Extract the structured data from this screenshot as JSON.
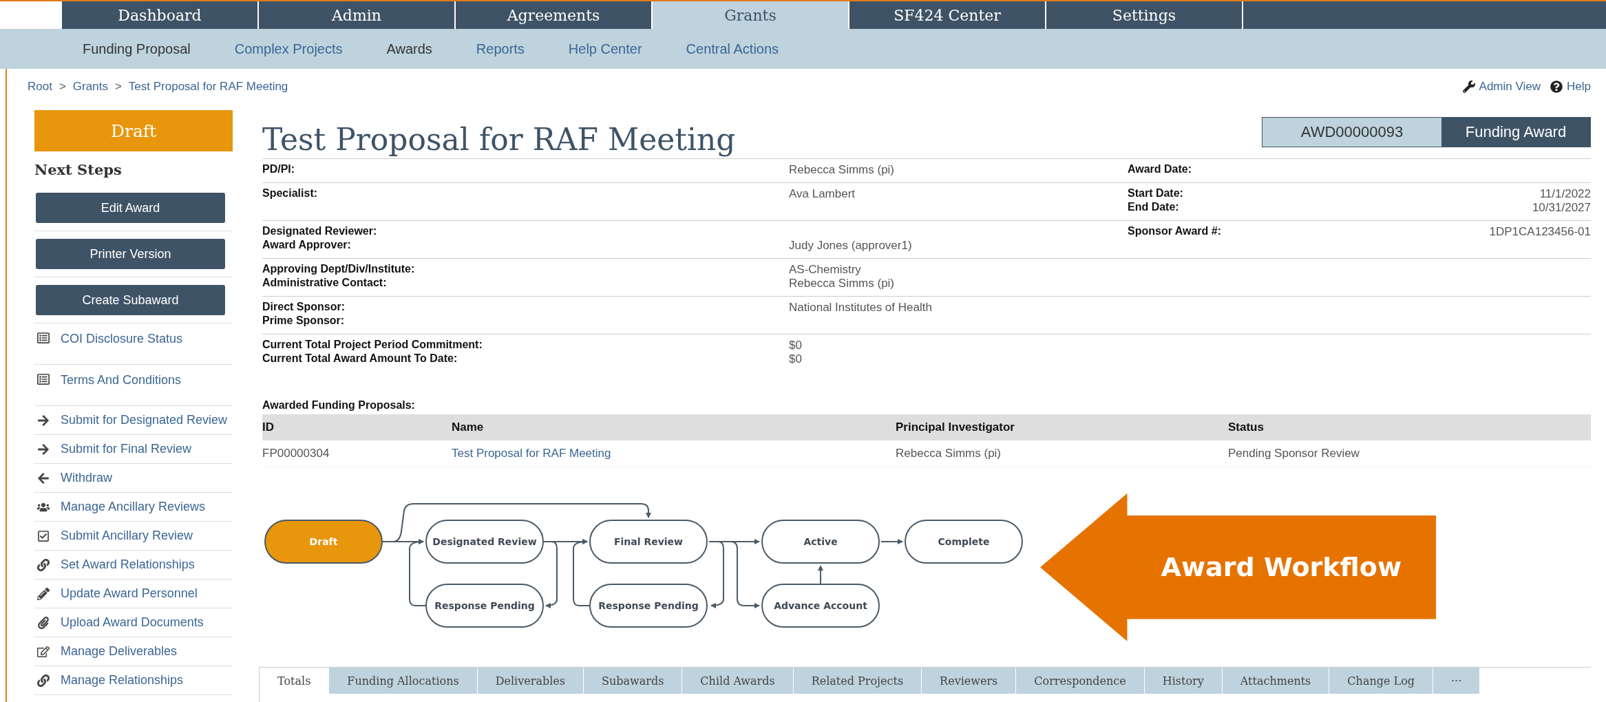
{
  "top_nav": [
    {
      "label": "Dashboard",
      "selected": false
    },
    {
      "label": "Admin",
      "selected": false
    },
    {
      "label": "Agreements",
      "selected": false
    },
    {
      "label": "Grants",
      "selected": true
    },
    {
      "label": "SF424 Center",
      "selected": false
    },
    {
      "label": "Settings",
      "selected": false
    }
  ],
  "sub_nav": [
    {
      "label": "Funding Proposal",
      "selected": true
    },
    {
      "label": "Complex Projects",
      "selected": false
    },
    {
      "label": "Awards",
      "selected": true
    },
    {
      "label": "Reports",
      "selected": false
    },
    {
      "label": "Help Center",
      "selected": false
    },
    {
      "label": "Central Actions",
      "selected": false
    }
  ],
  "breadcrumb": {
    "items": [
      "Root",
      "Grants",
      "Test Proposal for RAF Meeting"
    ],
    "separator": ">"
  },
  "header_links": [
    {
      "kind": "wrench",
      "label": "Admin View"
    },
    {
      "kind": "help",
      "label": "Help"
    }
  ],
  "sidebar": {
    "state": "Draft",
    "next_steps_title": "Next Steps",
    "buttons": [
      "Edit Award",
      "Printer Version",
      "Create Subaward"
    ],
    "items": [
      {
        "kind": "list",
        "label": "COI Disclosure Status"
      },
      {
        "kind": "list",
        "label": "Terms And Conditions"
      },
      {
        "kind": "forward",
        "label": "Submit for Designated Review"
      },
      {
        "kind": "forward",
        "label": "Submit for Final Review"
      },
      {
        "kind": "back",
        "label": "Withdraw"
      },
      {
        "kind": "users",
        "label": "Manage Ancillary Reviews"
      },
      {
        "kind": "check",
        "label": "Submit Ancillary Review"
      },
      {
        "kind": "link",
        "label": "Set Award Relationships"
      },
      {
        "kind": "pencil",
        "label": "Update Award Personnel"
      },
      {
        "kind": "clip",
        "label": "Upload Award Documents"
      },
      {
        "kind": "edit",
        "label": "Manage Deliverables"
      },
      {
        "kind": "link",
        "label": "Manage Relationships"
      }
    ]
  },
  "title": "Test Proposal for RAF Meeting",
  "award_id": "AWD00000093",
  "award_type": "Funding Award",
  "details": [
    {
      "lines": [
        {
          "label": "PD/PI:",
          "value": "Rebecca Simms (pi)",
          "right_label": "Award Date:"
        }
      ]
    },
    {
      "lines": [
        {
          "label": "Specialist:",
          "value": "Ava Lambert",
          "right_label": "Start Date:",
          "right_value": "11/1/2022"
        },
        {
          "right_label": "End Date:",
          "right_value": "10/31/2027"
        }
      ]
    },
    {
      "lines": [
        {
          "label": "Designated Reviewer:",
          "right_label": "Sponsor Award #:",
          "right_value": "1DP1CA123456-01"
        },
        {
          "label": "Award Approver:",
          "value": "Judy Jones (approver1)"
        }
      ]
    },
    {
      "lines": [
        {
          "label": "Approving Dept/Div/Institute:",
          "value": "AS-Chemistry"
        },
        {
          "label": "Administrative Contact:",
          "value": "Rebecca Simms (pi)"
        }
      ]
    },
    {
      "lines": [
        {
          "label": "Direct Sponsor:",
          "value": "National Institutes of Health"
        },
        {
          "label": "Prime Sponsor:"
        }
      ]
    },
    {
      "lines": [
        {
          "label": "Current Total Project Period Commitment:",
          "value": "$0"
        },
        {
          "label": "Current Total Award Amount To Date:",
          "value": "$0"
        }
      ]
    }
  ],
  "proposals": {
    "title": "Awarded Funding Proposals:",
    "columns": [
      "ID",
      "Name",
      "Principal Investigator",
      "Status"
    ],
    "rows": [
      [
        "FP00000304",
        "Test Proposal for RAF Meeting",
        "Rebecca Simms (pi)",
        "Pending Sponsor Review"
      ]
    ]
  },
  "workflow": {
    "nodes": [
      {
        "label": "Draft",
        "selected": true
      },
      {
        "label": "Designated Review",
        "selected": false
      },
      {
        "label": "Final Review",
        "selected": false
      },
      {
        "label": "Active",
        "selected": false
      },
      {
        "label": "Complete",
        "selected": false
      },
      {
        "label": "Response Pending",
        "selected": false
      },
      {
        "label": "Response Pending",
        "selected": false
      },
      {
        "label": "Advance Account",
        "selected": false
      }
    ],
    "callout": "Award Workflow"
  },
  "tabs": [
    {
      "label": "Totals",
      "selected": true
    },
    {
      "label": "Funding Allocations",
      "selected": false
    },
    {
      "label": "Deliverables",
      "selected": false
    },
    {
      "label": "Subawards",
      "selected": false
    },
    {
      "label": "Child Awards",
      "selected": false
    },
    {
      "label": "Related Projects",
      "selected": false
    },
    {
      "label": "Reviewers",
      "selected": false
    },
    {
      "label": "Correspondence",
      "selected": false
    },
    {
      "label": "History",
      "selected": false
    },
    {
      "label": "Attachments",
      "selected": false
    },
    {
      "label": "Change Log",
      "selected": false
    },
    {
      "label": "···",
      "selected": false
    }
  ]
}
